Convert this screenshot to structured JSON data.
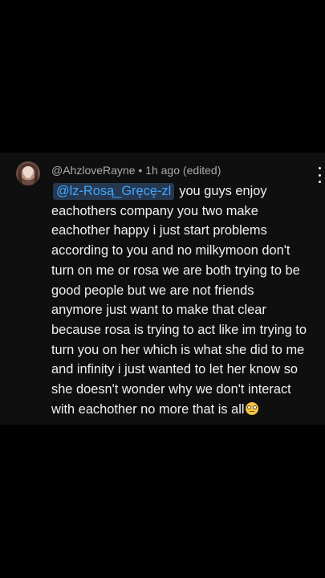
{
  "comment": {
    "author": "@AhzloveRayne",
    "separator": "•",
    "timestamp": "1h ago",
    "edited": "(edited)",
    "mention": "@lz-Rosą_Gręcę-zl",
    "lines": [
      "you guys enjoy",
      "eachothers company you two make",
      "eachother happy i just start problems",
      "according to you and no milkymoon don't",
      "turn on me or rosa we are both trying to be",
      "good people but we are not friends",
      "anymore just want to make that clear",
      "because rosa is trying to act like im trying to",
      "turn you on her which is what she did to me",
      "and infinity i just wanted to let her know so",
      "she doesn't wonder why we don't interact",
      "with eachother no more that is all"
    ],
    "emoji": "eye-roll-emoji"
  },
  "colors": {
    "background": "#000000",
    "card": "#0f0f0f",
    "text": "#f1f1f1",
    "meta": "#aaaaaa",
    "mention_text": "#3ea6ff",
    "mention_bg": "#263850"
  },
  "icons": {
    "menu": "more-vertical-icon"
  }
}
